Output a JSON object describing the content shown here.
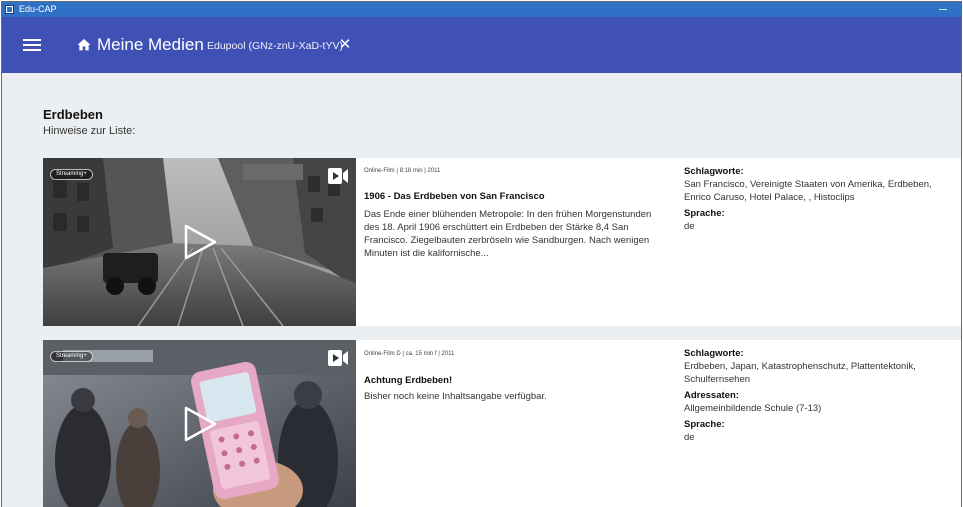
{
  "window": {
    "title": "Edu-CAP"
  },
  "appbar": {
    "title": "Meine Medien",
    "subtitle": "Edupool (GNz-znU-XaD-tYV)",
    "close_symbol": "✕",
    "icons": [
      "menu-icon",
      "home-icon",
      "close-icon"
    ]
  },
  "list": {
    "title": "Erdbeben",
    "hint": "Hinweise zur Liste:"
  },
  "items": [
    {
      "badge": "Streaming+",
      "meta": "Online-Film | 8:18 min | 2011",
      "title": "1906 - Das Erdbeben von San Francisco",
      "description": "Das Ende einer blühenden Metropole: In den frühen Morgenstunden des 18. April 1906 erschüttert ein Erdbeben der Stärke 8,4 San Francisco. Ziegelbauten zerbröseln wie Sandburgen. Nach wenigen Minuten ist die kalifornische...",
      "props": [
        {
          "label": "Schlagworte:",
          "value": "San Francisco, Vereinigte Staaten von Amerika, Erdbeben, Enrico Caruso, Hotel Palace, , Histoclips"
        },
        {
          "label": "Sprache:",
          "value": "de"
        }
      ]
    },
    {
      "badge": "Streaming+",
      "meta": "Online-Film D | ca. 15 min f | 2011",
      "title": "Achtung Erdbeben!",
      "description": "Bisher noch keine Inhaltsangabe verfügbar.",
      "props": [
        {
          "label": "Schlagworte:",
          "value": "Erdbeben, Japan, Katastrophenschutz, Plattentektonik, Schulfernsehen"
        },
        {
          "label": "Adressaten:",
          "value": "Allgemeinbildende Schule (7-13)"
        },
        {
          "label": "Sprache:",
          "value": "de"
        }
      ]
    }
  ],
  "colors": {
    "titlebar": "#2f71c6",
    "appbar": "#3f51b5",
    "content_bg": "#eceff1"
  }
}
